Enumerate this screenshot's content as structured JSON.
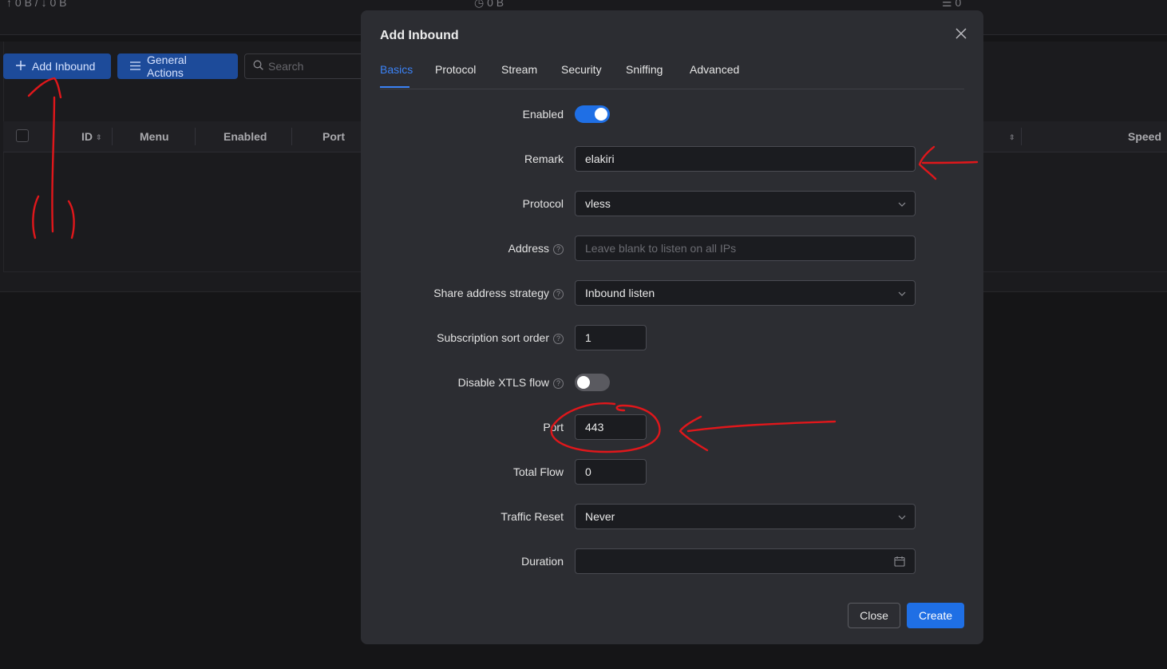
{
  "top_stats": {
    "traffic": "↑ 0 B / ↓ 0 B",
    "total": "0 B",
    "count": "0"
  },
  "toolbar": {
    "add_inbound_label": "Add Inbound",
    "general_actions_label": "General Actions",
    "search_placeholder": "Search"
  },
  "table": {
    "columns": [
      "ID",
      "Menu",
      "Enabled",
      "Port",
      "Speed"
    ]
  },
  "modal": {
    "title": "Add Inbound",
    "tabs": [
      "Basics",
      "Protocol",
      "Stream",
      "Security",
      "Sniffing",
      "Advanced"
    ],
    "active_tab": "Basics",
    "fields": {
      "enabled": {
        "label": "Enabled",
        "value": true
      },
      "remark": {
        "label": "Remark",
        "value": "elakiri"
      },
      "protocol": {
        "label": "Protocol",
        "value": "vless"
      },
      "address": {
        "label": "Address",
        "placeholder": "Leave blank to listen on all IPs",
        "value": ""
      },
      "share_strategy": {
        "label": "Share address strategy",
        "value": "Inbound listen"
      },
      "sub_sort": {
        "label": "Subscription sort order",
        "value": "1"
      },
      "disable_xtls": {
        "label": "Disable XTLS flow",
        "value": false
      },
      "port": {
        "label": "Port",
        "value": "443"
      },
      "total_flow": {
        "label": "Total Flow",
        "value": "0"
      },
      "traffic_reset": {
        "label": "Traffic Reset",
        "value": "Never"
      },
      "duration": {
        "label": "Duration",
        "value": ""
      }
    },
    "close_label": "Close",
    "create_label": "Create"
  },
  "colors": {
    "accent": "#1f6fe5",
    "annotation": "#e0171b",
    "modal_bg": "#2c2d32",
    "page_bg": "#151517"
  }
}
